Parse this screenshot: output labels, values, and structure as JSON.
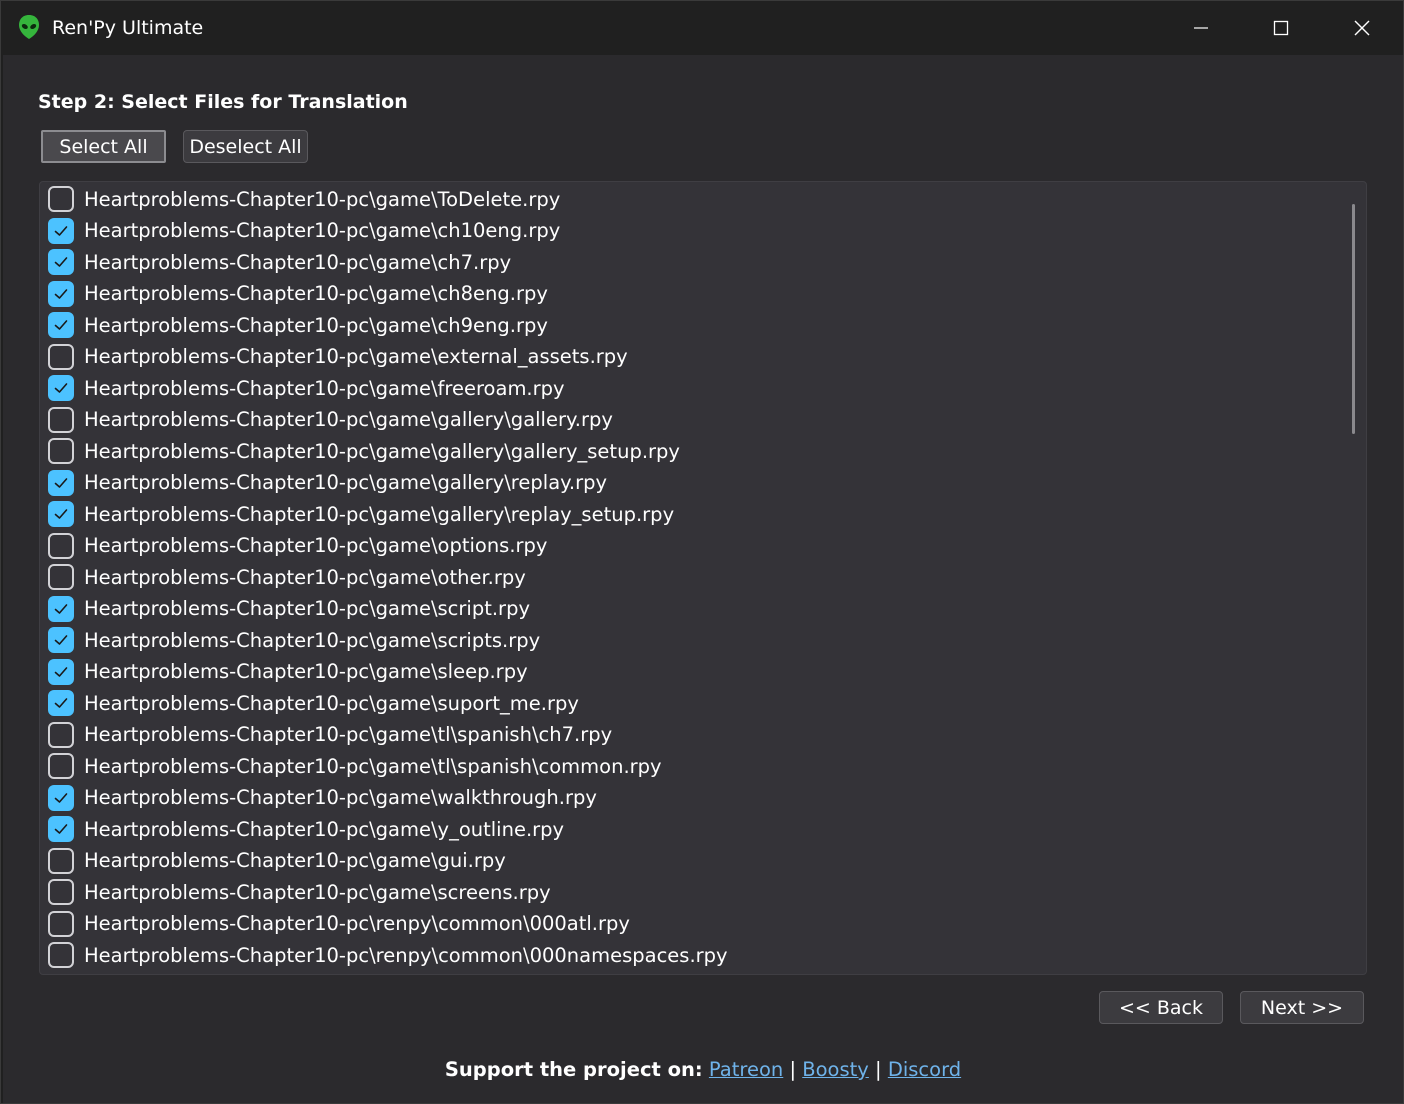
{
  "window": {
    "title": "Ren'Py Ultimate",
    "icon": "alien-head-icon"
  },
  "step": {
    "title": "Step 2: Select Files for Translation"
  },
  "toolbar": {
    "select_all_label": "Select All",
    "deselect_all_label": "Deselect All"
  },
  "files": [
    {
      "path": "Heartproblems-Chapter10-pc\\game\\ToDelete.rpy",
      "checked": false
    },
    {
      "path": "Heartproblems-Chapter10-pc\\game\\ch10eng.rpy",
      "checked": true
    },
    {
      "path": "Heartproblems-Chapter10-pc\\game\\ch7.rpy",
      "checked": true
    },
    {
      "path": "Heartproblems-Chapter10-pc\\game\\ch8eng.rpy",
      "checked": true
    },
    {
      "path": "Heartproblems-Chapter10-pc\\game\\ch9eng.rpy",
      "checked": true
    },
    {
      "path": "Heartproblems-Chapter10-pc\\game\\external_assets.rpy",
      "checked": false
    },
    {
      "path": "Heartproblems-Chapter10-pc\\game\\freeroam.rpy",
      "checked": true
    },
    {
      "path": "Heartproblems-Chapter10-pc\\game\\gallery\\gallery.rpy",
      "checked": false
    },
    {
      "path": "Heartproblems-Chapter10-pc\\game\\gallery\\gallery_setup.rpy",
      "checked": false
    },
    {
      "path": "Heartproblems-Chapter10-pc\\game\\gallery\\replay.rpy",
      "checked": true
    },
    {
      "path": "Heartproblems-Chapter10-pc\\game\\gallery\\replay_setup.rpy",
      "checked": true
    },
    {
      "path": "Heartproblems-Chapter10-pc\\game\\options.rpy",
      "checked": false
    },
    {
      "path": "Heartproblems-Chapter10-pc\\game\\other.rpy",
      "checked": false
    },
    {
      "path": "Heartproblems-Chapter10-pc\\game\\script.rpy",
      "checked": true
    },
    {
      "path": "Heartproblems-Chapter10-pc\\game\\scripts.rpy",
      "checked": true
    },
    {
      "path": "Heartproblems-Chapter10-pc\\game\\sleep.rpy",
      "checked": true
    },
    {
      "path": "Heartproblems-Chapter10-pc\\game\\suport_me.rpy",
      "checked": true
    },
    {
      "path": "Heartproblems-Chapter10-pc\\game\\tl\\spanish\\ch7.rpy",
      "checked": false
    },
    {
      "path": "Heartproblems-Chapter10-pc\\game\\tl\\spanish\\common.rpy",
      "checked": false
    },
    {
      "path": "Heartproblems-Chapter10-pc\\game\\walkthrough.rpy",
      "checked": true
    },
    {
      "path": "Heartproblems-Chapter10-pc\\game\\y_outline.rpy",
      "checked": true
    },
    {
      "path": "Heartproblems-Chapter10-pc\\game\\gui.rpy",
      "checked": false
    },
    {
      "path": "Heartproblems-Chapter10-pc\\game\\screens.rpy",
      "checked": false
    },
    {
      "path": "Heartproblems-Chapter10-pc\\renpy\\common\\000atl.rpy",
      "checked": false
    },
    {
      "path": "Heartproblems-Chapter10-pc\\renpy\\common\\000namespaces.rpy",
      "checked": false
    }
  ],
  "nav": {
    "back_label": "<< Back",
    "next_label": "Next >>"
  },
  "support": {
    "lead": "Support the project on:",
    "separator": "|",
    "links": [
      "Patreon",
      "Boosty",
      "Discord"
    ]
  },
  "colors": {
    "accent": "#4cc2ff",
    "link": "#6fb3ea",
    "background": "#2b2a2d",
    "list_background": "#343338"
  }
}
